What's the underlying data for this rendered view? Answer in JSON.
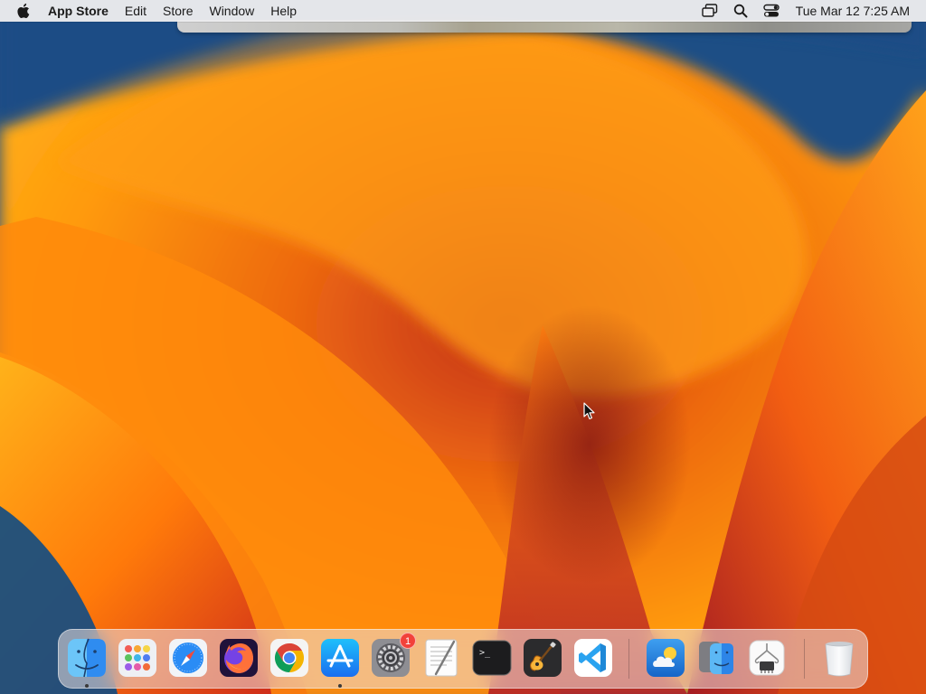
{
  "menubar": {
    "apple_icon": "apple-logo-icon",
    "app_name": "App Store",
    "menus": [
      "Edit",
      "Store",
      "Window",
      "Help"
    ],
    "status_icons": [
      "screen-mirroring-icon",
      "spotlight-search-icon",
      "control-center-icon"
    ],
    "clock": "Tue Mar 12  7:25 AM"
  },
  "dock": {
    "apps": [
      {
        "name": "Finder",
        "icon": "finder-icon",
        "running": true
      },
      {
        "name": "Launchpad",
        "icon": "launchpad-icon",
        "running": false
      },
      {
        "name": "Safari",
        "icon": "safari-icon",
        "running": false
      },
      {
        "name": "Firefox",
        "icon": "firefox-icon",
        "running": false
      },
      {
        "name": "Google Chrome",
        "icon": "chrome-icon",
        "running": false
      },
      {
        "name": "App Store",
        "icon": "app-store-icon",
        "running": true
      },
      {
        "name": "System Settings",
        "icon": "system-settings-icon",
        "running": false,
        "badge": "1"
      },
      {
        "name": "TextEdit",
        "icon": "textedit-icon",
        "running": false
      },
      {
        "name": "Terminal",
        "icon": "terminal-icon",
        "running": false
      },
      {
        "name": "GarageBand",
        "icon": "garageband-icon",
        "running": false
      },
      {
        "name": "Visual Studio Code",
        "icon": "vscode-icon",
        "running": false
      }
    ],
    "recents": [
      {
        "name": "Weather",
        "icon": "weather-icon"
      },
      {
        "name": "Migration Assistant",
        "icon": "migration-assistant-icon"
      },
      {
        "name": "System Information",
        "icon": "system-information-icon"
      }
    ],
    "trash": {
      "name": "Trash",
      "icon": "trash-icon"
    },
    "terminal_prompt": ">_"
  },
  "colors": {
    "wallpaper_blue": "#1e4f86",
    "wallpaper_orange": "#ff8a00",
    "wallpaper_red": "#b3261e",
    "badge_red": "#f2423a",
    "menubar_bg": "#ececee"
  }
}
